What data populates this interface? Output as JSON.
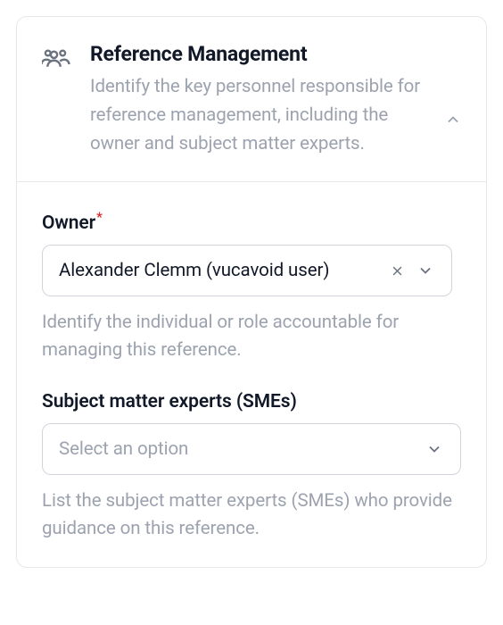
{
  "header": {
    "title": "Reference Management",
    "description": "Identify the key personnel responsible for reference management, including the owner and subject matter experts."
  },
  "fields": {
    "owner": {
      "label": "Owner",
      "required": true,
      "value": "Alexander Clemm (vucavoid user)",
      "help": "Identify the individual or role accountable for managing this reference."
    },
    "smes": {
      "label": "Subject matter experts (SMEs)",
      "placeholder": "Select an option",
      "help": "List the subject matter experts (SMEs) who provide guidance on this reference."
    }
  }
}
